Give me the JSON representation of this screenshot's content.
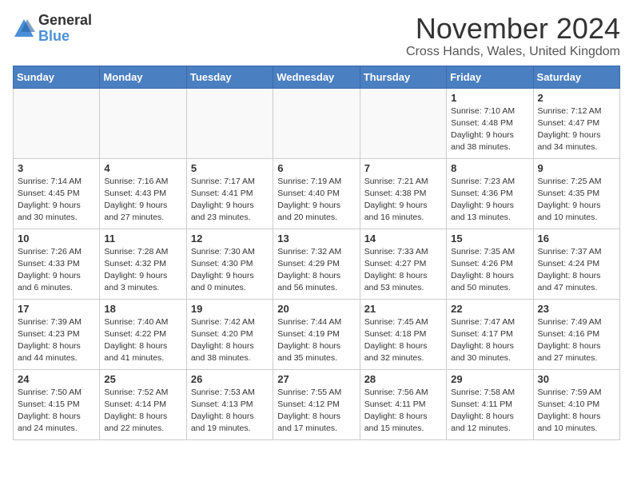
{
  "logo": {
    "general": "General",
    "blue": "Blue"
  },
  "title": "November 2024",
  "location": "Cross Hands, Wales, United Kingdom",
  "days_of_week": [
    "Sunday",
    "Monday",
    "Tuesday",
    "Wednesday",
    "Thursday",
    "Friday",
    "Saturday"
  ],
  "weeks": [
    [
      {
        "day": "",
        "sunrise": "",
        "sunset": "",
        "daylight": ""
      },
      {
        "day": "",
        "sunrise": "",
        "sunset": "",
        "daylight": ""
      },
      {
        "day": "",
        "sunrise": "",
        "sunset": "",
        "daylight": ""
      },
      {
        "day": "",
        "sunrise": "",
        "sunset": "",
        "daylight": ""
      },
      {
        "day": "",
        "sunrise": "",
        "sunset": "",
        "daylight": ""
      },
      {
        "day": "1",
        "sunrise": "Sunrise: 7:10 AM",
        "sunset": "Sunset: 4:48 PM",
        "daylight": "Daylight: 9 hours and 38 minutes."
      },
      {
        "day": "2",
        "sunrise": "Sunrise: 7:12 AM",
        "sunset": "Sunset: 4:47 PM",
        "daylight": "Daylight: 9 hours and 34 minutes."
      }
    ],
    [
      {
        "day": "3",
        "sunrise": "Sunrise: 7:14 AM",
        "sunset": "Sunset: 4:45 PM",
        "daylight": "Daylight: 9 hours and 30 minutes."
      },
      {
        "day": "4",
        "sunrise": "Sunrise: 7:16 AM",
        "sunset": "Sunset: 4:43 PM",
        "daylight": "Daylight: 9 hours and 27 minutes."
      },
      {
        "day": "5",
        "sunrise": "Sunrise: 7:17 AM",
        "sunset": "Sunset: 4:41 PM",
        "daylight": "Daylight: 9 hours and 23 minutes."
      },
      {
        "day": "6",
        "sunrise": "Sunrise: 7:19 AM",
        "sunset": "Sunset: 4:40 PM",
        "daylight": "Daylight: 9 hours and 20 minutes."
      },
      {
        "day": "7",
        "sunrise": "Sunrise: 7:21 AM",
        "sunset": "Sunset: 4:38 PM",
        "daylight": "Daylight: 9 hours and 16 minutes."
      },
      {
        "day": "8",
        "sunrise": "Sunrise: 7:23 AM",
        "sunset": "Sunset: 4:36 PM",
        "daylight": "Daylight: 9 hours and 13 minutes."
      },
      {
        "day": "9",
        "sunrise": "Sunrise: 7:25 AM",
        "sunset": "Sunset: 4:35 PM",
        "daylight": "Daylight: 9 hours and 10 minutes."
      }
    ],
    [
      {
        "day": "10",
        "sunrise": "Sunrise: 7:26 AM",
        "sunset": "Sunset: 4:33 PM",
        "daylight": "Daylight: 9 hours and 6 minutes."
      },
      {
        "day": "11",
        "sunrise": "Sunrise: 7:28 AM",
        "sunset": "Sunset: 4:32 PM",
        "daylight": "Daylight: 9 hours and 3 minutes."
      },
      {
        "day": "12",
        "sunrise": "Sunrise: 7:30 AM",
        "sunset": "Sunset: 4:30 PM",
        "daylight": "Daylight: 9 hours and 0 minutes."
      },
      {
        "day": "13",
        "sunrise": "Sunrise: 7:32 AM",
        "sunset": "Sunset: 4:29 PM",
        "daylight": "Daylight: 8 hours and 56 minutes."
      },
      {
        "day": "14",
        "sunrise": "Sunrise: 7:33 AM",
        "sunset": "Sunset: 4:27 PM",
        "daylight": "Daylight: 8 hours and 53 minutes."
      },
      {
        "day": "15",
        "sunrise": "Sunrise: 7:35 AM",
        "sunset": "Sunset: 4:26 PM",
        "daylight": "Daylight: 8 hours and 50 minutes."
      },
      {
        "day": "16",
        "sunrise": "Sunrise: 7:37 AM",
        "sunset": "Sunset: 4:24 PM",
        "daylight": "Daylight: 8 hours and 47 minutes."
      }
    ],
    [
      {
        "day": "17",
        "sunrise": "Sunrise: 7:39 AM",
        "sunset": "Sunset: 4:23 PM",
        "daylight": "Daylight: 8 hours and 44 minutes."
      },
      {
        "day": "18",
        "sunrise": "Sunrise: 7:40 AM",
        "sunset": "Sunset: 4:22 PM",
        "daylight": "Daylight: 8 hours and 41 minutes."
      },
      {
        "day": "19",
        "sunrise": "Sunrise: 7:42 AM",
        "sunset": "Sunset: 4:20 PM",
        "daylight": "Daylight: 8 hours and 38 minutes."
      },
      {
        "day": "20",
        "sunrise": "Sunrise: 7:44 AM",
        "sunset": "Sunset: 4:19 PM",
        "daylight": "Daylight: 8 hours and 35 minutes."
      },
      {
        "day": "21",
        "sunrise": "Sunrise: 7:45 AM",
        "sunset": "Sunset: 4:18 PM",
        "daylight": "Daylight: 8 hours and 32 minutes."
      },
      {
        "day": "22",
        "sunrise": "Sunrise: 7:47 AM",
        "sunset": "Sunset: 4:17 PM",
        "daylight": "Daylight: 8 hours and 30 minutes."
      },
      {
        "day": "23",
        "sunrise": "Sunrise: 7:49 AM",
        "sunset": "Sunset: 4:16 PM",
        "daylight": "Daylight: 8 hours and 27 minutes."
      }
    ],
    [
      {
        "day": "24",
        "sunrise": "Sunrise: 7:50 AM",
        "sunset": "Sunset: 4:15 PM",
        "daylight": "Daylight: 8 hours and 24 minutes."
      },
      {
        "day": "25",
        "sunrise": "Sunrise: 7:52 AM",
        "sunset": "Sunset: 4:14 PM",
        "daylight": "Daylight: 8 hours and 22 minutes."
      },
      {
        "day": "26",
        "sunrise": "Sunrise: 7:53 AM",
        "sunset": "Sunset: 4:13 PM",
        "daylight": "Daylight: 8 hours and 19 minutes."
      },
      {
        "day": "27",
        "sunrise": "Sunrise: 7:55 AM",
        "sunset": "Sunset: 4:12 PM",
        "daylight": "Daylight: 8 hours and 17 minutes."
      },
      {
        "day": "28",
        "sunrise": "Sunrise: 7:56 AM",
        "sunset": "Sunset: 4:11 PM",
        "daylight": "Daylight: 8 hours and 15 minutes."
      },
      {
        "day": "29",
        "sunrise": "Sunrise: 7:58 AM",
        "sunset": "Sunset: 4:11 PM",
        "daylight": "Daylight: 8 hours and 12 minutes."
      },
      {
        "day": "30",
        "sunrise": "Sunrise: 7:59 AM",
        "sunset": "Sunset: 4:10 PM",
        "daylight": "Daylight: 8 hours and 10 minutes."
      }
    ]
  ]
}
